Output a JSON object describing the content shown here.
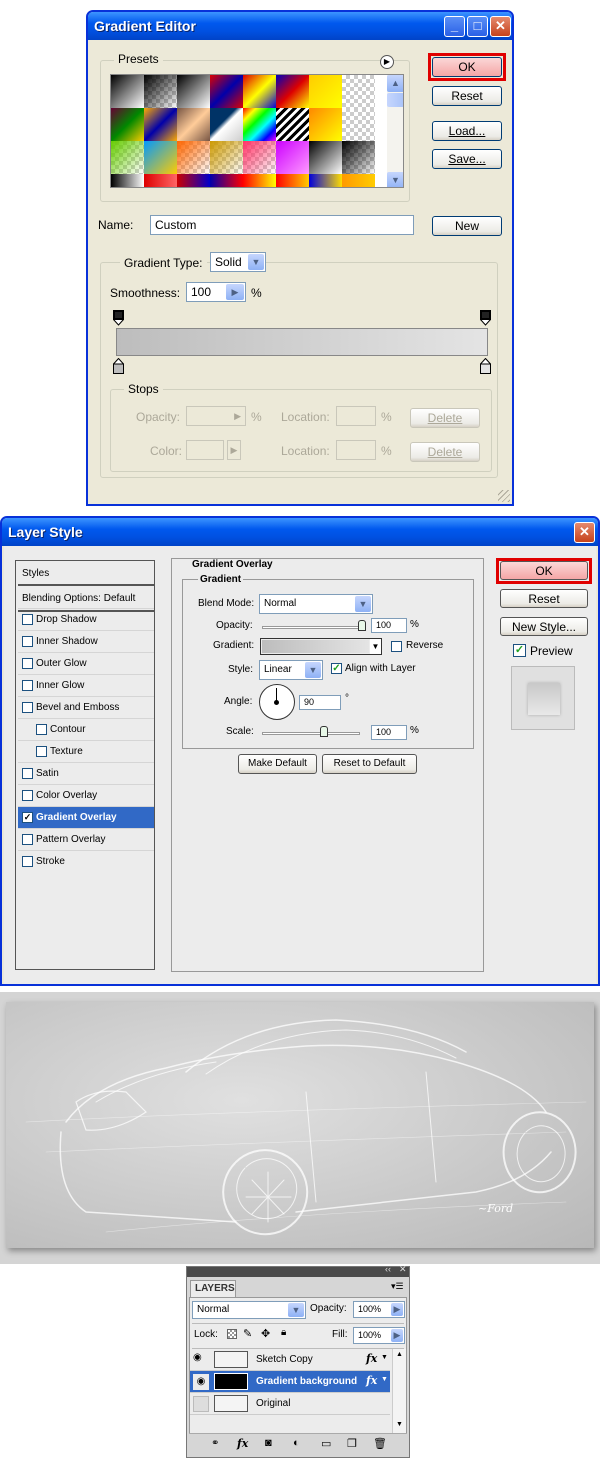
{
  "gradient_editor": {
    "title": "Gradient Editor",
    "presets_label": "Presets",
    "buttons": {
      "ok": "OK",
      "reset": "Reset",
      "load": "Load...",
      "save": "Save...",
      "new": "New"
    },
    "name_label": "Name:",
    "name_value": "Custom",
    "gradient_type_label": "Gradient Type:",
    "gradient_type_value": "Solid",
    "smoothness_label": "Smoothness:",
    "smoothness_value": "100",
    "smoothness_unit": "%",
    "stops": {
      "legend": "Stops",
      "opacity_label": "Opacity:",
      "pct": "%",
      "location_label": "Location:",
      "color_label": "Color:",
      "delete_label": "Delete"
    }
  },
  "layer_style": {
    "title": "Layer Style",
    "styles_header": "Styles",
    "blending_options": "Blending Options: Default",
    "items": [
      {
        "label": "Drop Shadow",
        "checked": false
      },
      {
        "label": "Inner Shadow",
        "checked": false
      },
      {
        "label": "Outer Glow",
        "checked": false
      },
      {
        "label": "Inner Glow",
        "checked": false
      },
      {
        "label": "Bevel and Emboss",
        "checked": false
      },
      {
        "label": "Contour",
        "checked": false
      },
      {
        "label": "Texture",
        "checked": false
      },
      {
        "label": "Satin",
        "checked": false
      },
      {
        "label": "Color Overlay",
        "checked": false
      },
      {
        "label": "Gradient Overlay",
        "checked": true
      },
      {
        "label": "Pattern Overlay",
        "checked": false
      },
      {
        "label": "Stroke",
        "checked": false
      }
    ],
    "section_title": "Gradient Overlay",
    "group_title": "Gradient",
    "blend_mode_label": "Blend Mode:",
    "blend_mode_value": "Normal",
    "opacity_label": "Opacity:",
    "opacity_value": "100",
    "opacity_level": 1.0,
    "pct": "%",
    "gradient_label": "Gradient:",
    "reverse_label": "Reverse",
    "reverse_checked": false,
    "style_label": "Style:",
    "style_value": "Linear",
    "align_label": "Align with Layer",
    "align_checked": true,
    "angle_label": "Angle:",
    "angle_value": "90",
    "degree": "°",
    "scale_label": "Scale:",
    "scale_value": "100",
    "scale_level": 0.5,
    "make_default": "Make Default",
    "reset_default": "Reset to Default",
    "buttons": {
      "ok": "OK",
      "reset": "Reset",
      "new_style": "New Style...",
      "preview": "Preview"
    },
    "preview_checked": true
  },
  "canvas": {
    "signature": "~Ford"
  },
  "layers": {
    "tab": "LAYERS",
    "blend_mode": "Normal",
    "opacity_label": "Opacity:",
    "opacity_value": "100%",
    "lock_label": "Lock:",
    "fill_label": "Fill:",
    "fill_value": "100%",
    "rows": [
      {
        "name": "Sketch Copy",
        "selected": false,
        "fx": true
      },
      {
        "name": "Gradient background",
        "selected": true,
        "fx": true
      },
      {
        "name": "Original",
        "selected": false,
        "fx": false
      }
    ],
    "fx_glyph": "fx"
  },
  "colors": {
    "xp_blue": "#0058ee",
    "highlight": "#3169c6",
    "ok_outline": "#e00000"
  }
}
